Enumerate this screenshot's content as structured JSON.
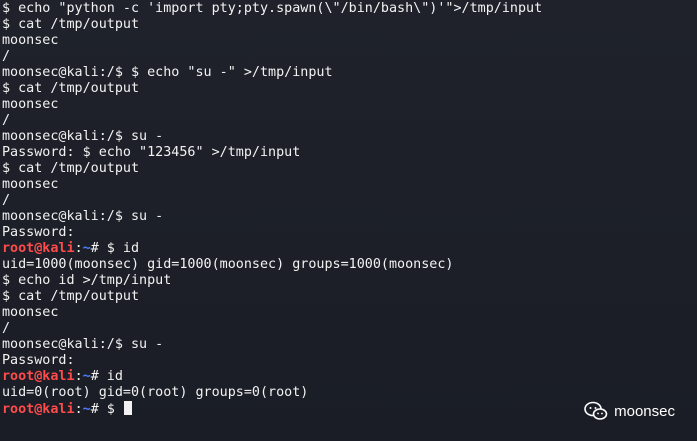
{
  "terminal": {
    "lines": [
      {
        "type": "plain",
        "text": "$ echo \"python -c 'import pty;pty.spawn(\\\"/bin/bash\\\")'\">/tmp/input"
      },
      {
        "type": "plain",
        "text": "$ cat /tmp/output"
      },
      {
        "type": "plain",
        "text": "moonsec"
      },
      {
        "type": "plain",
        "text": "/"
      },
      {
        "type": "plain",
        "text": "moonsec@kali:/$ $ echo \"su -\" >/tmp/input"
      },
      {
        "type": "plain",
        "text": "$ cat /tmp/output"
      },
      {
        "type": "plain",
        "text": "moonsec"
      },
      {
        "type": "plain",
        "text": "/"
      },
      {
        "type": "plain",
        "text": "moonsec@kali:/$ su -"
      },
      {
        "type": "plain",
        "text": "Password: $ echo \"123456\" >/tmp/input"
      },
      {
        "type": "plain",
        "text": "$ cat /tmp/output"
      },
      {
        "type": "plain",
        "text": "moonsec"
      },
      {
        "type": "plain",
        "text": "/"
      },
      {
        "type": "plain",
        "text": "moonsec@kali:/$ su -"
      },
      {
        "type": "plain",
        "text": "Password:"
      },
      {
        "type": "root",
        "user": "root@kali",
        "colon": ":",
        "path": "~",
        "rest": "# $ id"
      },
      {
        "type": "plain",
        "text": "uid=1000(moonsec) gid=1000(moonsec) groups=1000(moonsec)"
      },
      {
        "type": "plain",
        "text": "$ echo id >/tmp/input"
      },
      {
        "type": "plain",
        "text": "$ cat /tmp/output"
      },
      {
        "type": "plain",
        "text": "moonsec"
      },
      {
        "type": "plain",
        "text": "/"
      },
      {
        "type": "plain",
        "text": "moonsec@kali:/$ su -"
      },
      {
        "type": "plain",
        "text": "Password:"
      },
      {
        "type": "root",
        "user": "root@kali",
        "colon": ":",
        "path": "~",
        "rest": "# id"
      },
      {
        "type": "plain",
        "text": "uid=0(root) gid=0(root) groups=0(root)"
      },
      {
        "type": "root",
        "user": "root@kali",
        "colon": ":",
        "path": "~",
        "rest": "# $ ",
        "cursor": true
      }
    ]
  },
  "watermark": {
    "text": "moonsec",
    "icon": "wechat-icon"
  },
  "colors": {
    "background": "#1c1f27",
    "text": "#f2f2f2",
    "root_user": "#ff4b4b",
    "path": "#4c7dff"
  }
}
